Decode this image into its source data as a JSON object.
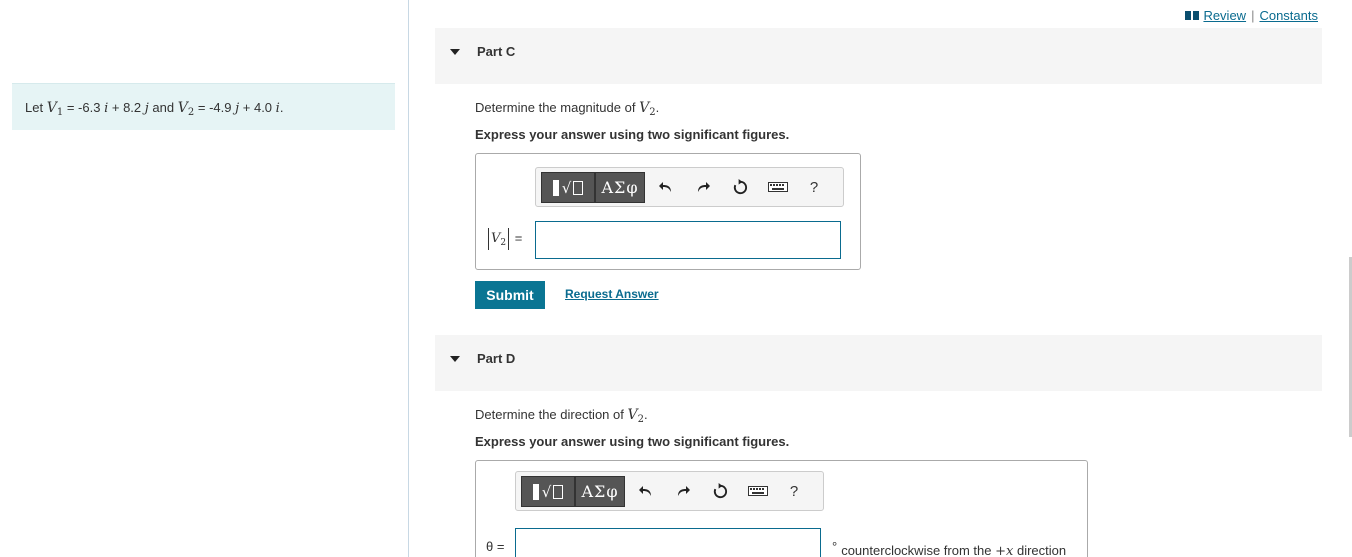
{
  "header": {
    "review_label": "Review",
    "separator": "|",
    "constants_label": "Constants"
  },
  "problem": {
    "let": "Let",
    "v": "V",
    "v1_sub": "1",
    "v2_sub": "2",
    "eq1": "= -6.3",
    "i_hat": "i",
    "plus1": "+ 8.2",
    "j_hat": "j",
    "and": "and",
    "eq2": "= -4.9",
    "plus2": "+ 4.0",
    "period": "."
  },
  "part_c": {
    "title": "Part C",
    "question_prefix": "Determine the magnitude of",
    "vec": "V",
    "vec_sub": "2",
    "period": ".",
    "instruction": "Express your answer using two significant figures.",
    "greek_label": "ΑΣφ",
    "help_label": "?",
    "field_vec": "V",
    "field_sub": "2",
    "field_eq": "=",
    "input_value": "",
    "submit_label": "Submit",
    "request_label": "Request Answer"
  },
  "part_d": {
    "title": "Part D",
    "question_prefix": "Determine the direction of",
    "vec": "V",
    "vec_sub": "2",
    "period": ".",
    "instruction": "Express your answer using two significant figures.",
    "greek_label": "ΑΣφ",
    "help_label": "?",
    "field_label": "θ =",
    "input_value": "",
    "unit_degree": "°",
    "unit_prefix": "counterclockwise from the",
    "unit_axis": "+x",
    "unit_suffix": "direction"
  },
  "icons": [
    "templates-icon",
    "greek-symbols-icon",
    "undo-icon",
    "redo-icon",
    "reset-icon",
    "keyboard-icon",
    "help-icon",
    "book-icon",
    "collapse-triangle-icon"
  ]
}
